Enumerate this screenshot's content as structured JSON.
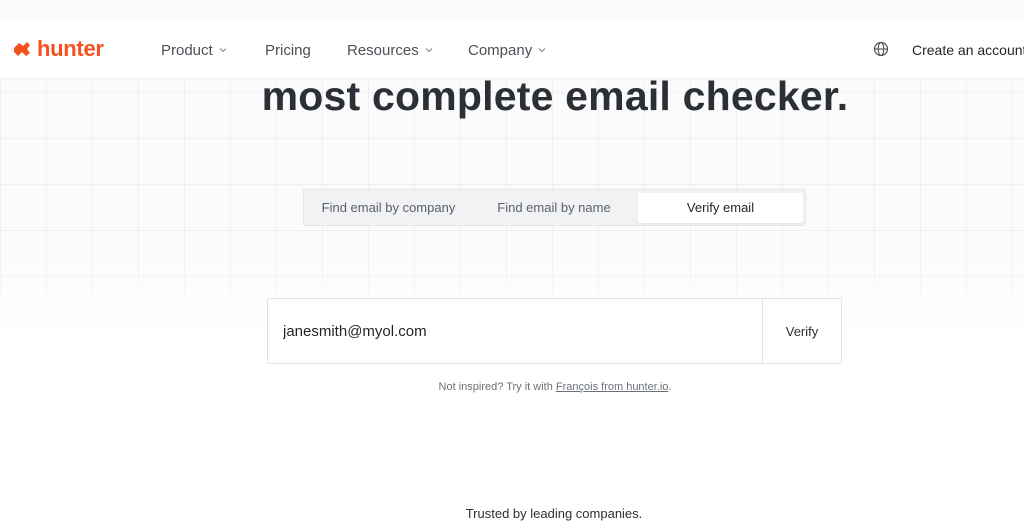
{
  "brand": {
    "name": "hunter",
    "color": "#f4511e"
  },
  "nav": {
    "items": [
      {
        "label": "Product",
        "has_dropdown": true
      },
      {
        "label": "Pricing",
        "has_dropdown": false
      },
      {
        "label": "Resources",
        "has_dropdown": true
      },
      {
        "label": "Company",
        "has_dropdown": true
      }
    ],
    "language_icon": "globe-icon",
    "create_account": "Create an account"
  },
  "hero": {
    "headline": "most complete email checker."
  },
  "tabs": [
    {
      "label": "Find email by company",
      "active": false
    },
    {
      "label": "Find email by name",
      "active": false
    },
    {
      "label": "Verify email",
      "active": true
    }
  ],
  "form": {
    "email_value": "janesmith@myol.com",
    "verify_label": "Verify"
  },
  "hint": {
    "prefix": "Not inspired? Try it with ",
    "link": "François from hunter.io",
    "suffix": "."
  },
  "trusted": "Trusted by leading companies."
}
